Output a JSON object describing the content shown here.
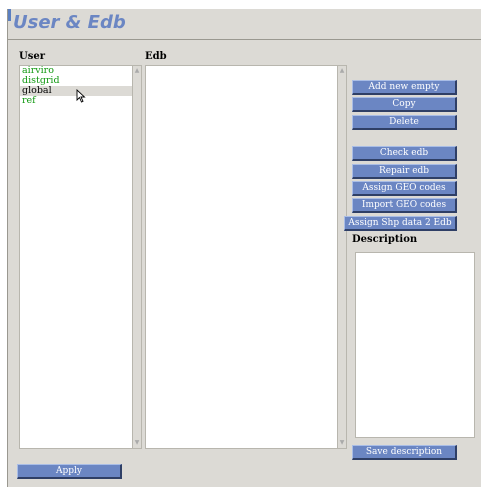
{
  "window": {
    "title": "User & Edb"
  },
  "user_list": {
    "header": "User",
    "items": [
      {
        "label": "airviro",
        "selected": false
      },
      {
        "label": "distgrid",
        "selected": false
      },
      {
        "label": "global",
        "selected": true
      },
      {
        "label": "ref",
        "selected": false
      }
    ]
  },
  "edb_list": {
    "header": "Edb",
    "items": []
  },
  "actions": {
    "add_new_empty": "Add new empty",
    "copy": "Copy",
    "delete": "Delete",
    "check_edb": "Check edb",
    "repair_edb": "Repair edb",
    "assign_geo_codes": "Assign GEO codes",
    "import_geo_codes": "Import GEO codes",
    "assign_shp_data": "Assign Shp data 2 Edb"
  },
  "description": {
    "label": "Description",
    "value": ""
  },
  "save_description": "Save description",
  "apply": "Apply",
  "colors": {
    "accent": "#6b86c3",
    "item_text": "#119911",
    "panel_bg": "#dcdad5"
  }
}
